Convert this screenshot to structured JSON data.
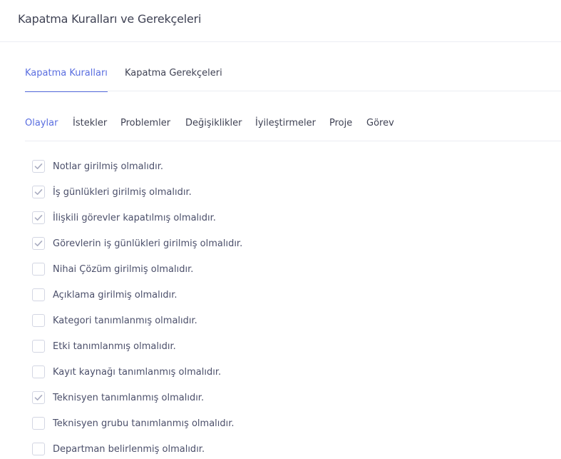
{
  "header": {
    "title": "Kapatma Kuralları ve Gerekçeleri"
  },
  "main_tabs": [
    {
      "label": "Kapatma Kuralları",
      "active": true
    },
    {
      "label": "Kapatma Gerekçeleri",
      "active": false
    }
  ],
  "sub_tabs": [
    {
      "label": "Olaylar",
      "active": true
    },
    {
      "label": "İstekler",
      "active": false
    },
    {
      "label": "Problemler",
      "active": false
    },
    {
      "label": "Değişiklikler",
      "active": false
    },
    {
      "label": "İyileştirmeler",
      "active": false
    },
    {
      "label": "Proje",
      "active": false
    },
    {
      "label": "Görev",
      "active": false
    }
  ],
  "rules": [
    {
      "label": "Notlar girilmiş olmalıdır.",
      "checked": true
    },
    {
      "label": "İş günlükleri girilmiş olmalıdır.",
      "checked": true
    },
    {
      "label": "İlişkili görevler kapatılmış olmalıdır.",
      "checked": true
    },
    {
      "label": "Görevlerin iş günlükleri girilmiş olmalıdır.",
      "checked": true
    },
    {
      "label": "Nihai Çözüm girilmiş olmalıdır.",
      "checked": false
    },
    {
      "label": "Açıklama girilmiş olmalıdır.",
      "checked": false
    },
    {
      "label": "Kategori tanımlanmış olmalıdır.",
      "checked": false
    },
    {
      "label": "Etki tanımlanmış olmalıdır.",
      "checked": false
    },
    {
      "label": "Kayıt kaynağı tanımlanmış olmalıdır.",
      "checked": false
    },
    {
      "label": "Teknisyen tanımlanmış olmalıdır.",
      "checked": true
    },
    {
      "label": "Teknisyen grubu tanımlanmış olmalıdır.",
      "checked": false
    },
    {
      "label": "Departman belirlenmiş olmalıdır.",
      "checked": false
    }
  ],
  "colors": {
    "accent": "#5a6ee0",
    "check": "#a9acc0",
    "border": "#ebedf3"
  },
  "icons": {
    "checkbox_mark": "check-icon"
  }
}
